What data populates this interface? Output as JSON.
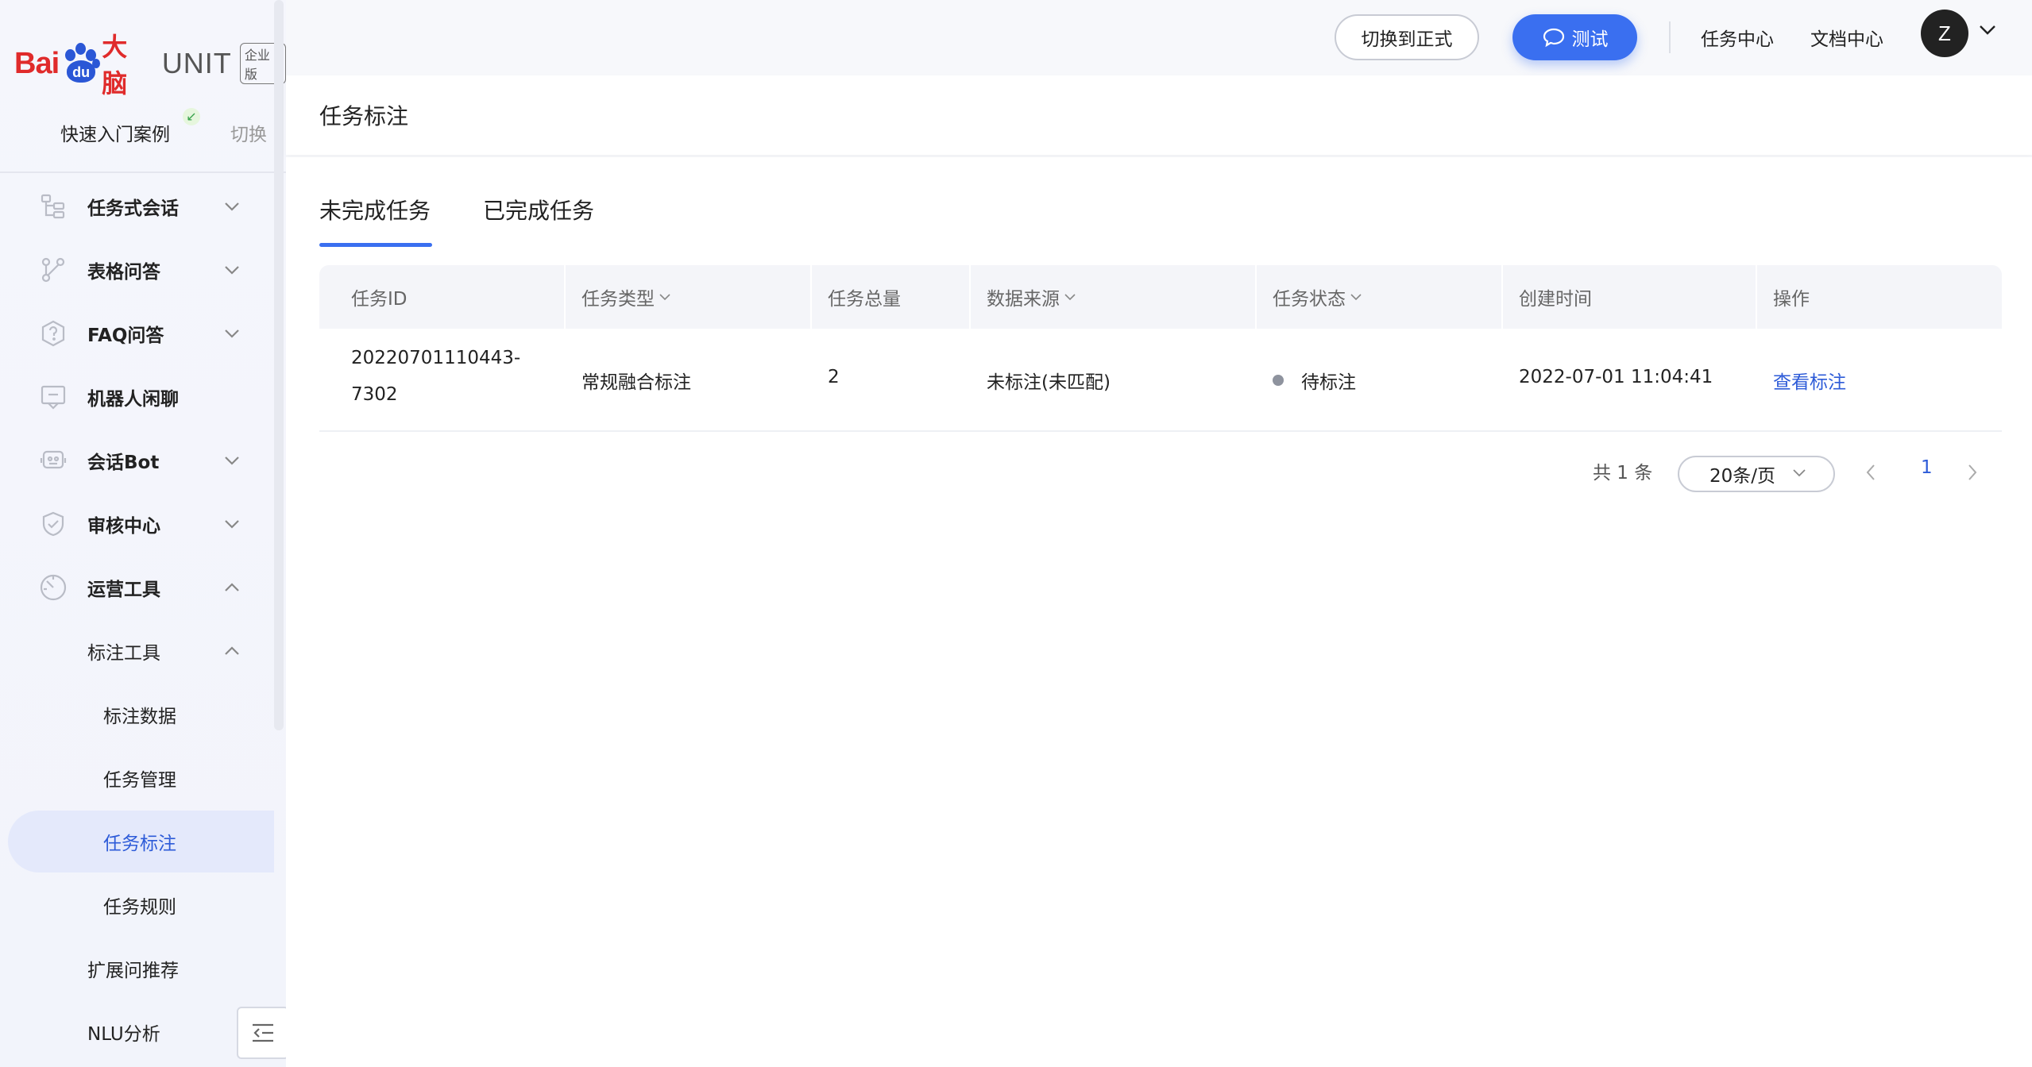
{
  "brand": {
    "logo_bai": "Bai",
    "logo_du": "du",
    "logo_cn": "大脑",
    "logo_unit": "UNIT",
    "logo_badge": "企业版"
  },
  "quick_start": {
    "label": "快速入门案例",
    "switch": "切换"
  },
  "menu": {
    "items": [
      {
        "label": "任务式会话",
        "icon": "flow-tree-icon",
        "expanded": false
      },
      {
        "label": "表格问答",
        "icon": "branch-icon",
        "expanded": false
      },
      {
        "label": "FAQ问答",
        "icon": "faq-shield-icon",
        "expanded": false
      },
      {
        "label": "机器人闲聊",
        "icon": "chat-box-icon"
      },
      {
        "label": "会话Bot",
        "icon": "robot-icon",
        "expanded": false
      },
      {
        "label": "审核中心",
        "icon": "shield-check-icon",
        "expanded": false
      },
      {
        "label": "运营工具",
        "icon": "gauge-icon",
        "expanded": true
      }
    ],
    "sub": {
      "label": "标注工具",
      "children": [
        "标注数据",
        "任务管理",
        "任务标注",
        "任务规则"
      ]
    },
    "extra": [
      "扩展问推荐",
      "NLU分析"
    ]
  },
  "topbar": {
    "switch_btn": "切换到正式",
    "test_btn": "测试",
    "nav": [
      "任务中心",
      "文档中心"
    ],
    "avatar": "Z"
  },
  "page": {
    "title": "任务标注",
    "tabs": [
      "未完成任务",
      "已完成任务"
    ],
    "table": {
      "headers": [
        "任务ID",
        "任务类型",
        "任务总量",
        "数据来源",
        "任务状态",
        "创建时间",
        "操作"
      ],
      "rows": [
        {
          "id_line1": "20220701110443-",
          "id_line2": "7302",
          "type": "常规融合标注",
          "total": "2",
          "source": "未标注(未匹配)",
          "status": "待标注",
          "created": "2022-07-01 11:04:41",
          "action": "查看标注"
        }
      ]
    },
    "pagination": {
      "total": "共 1 条",
      "page_size": "20条/页",
      "current": "1"
    }
  },
  "colors": {
    "accent": "#3a6ff0",
    "link": "#2d5bd8",
    "brand_red": "#e02b2b",
    "brand_blue": "#2b57d6"
  }
}
